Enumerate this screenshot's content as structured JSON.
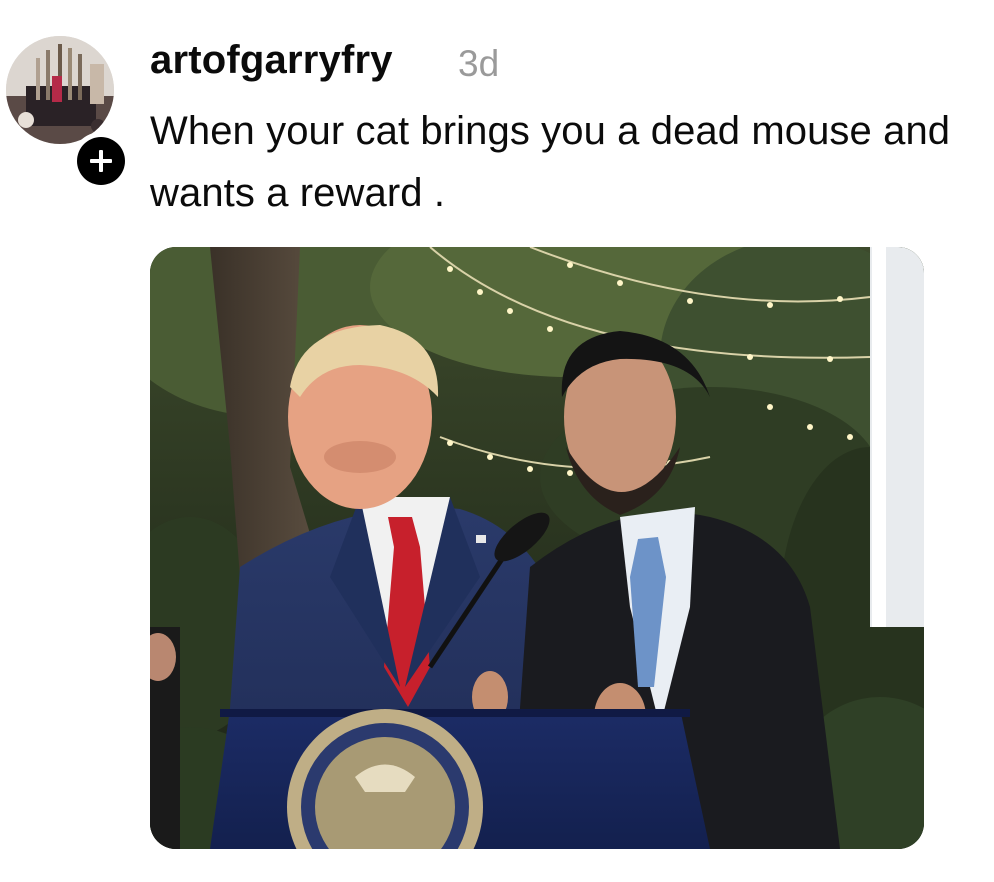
{
  "post": {
    "author": {
      "username": "artofgarryfry",
      "avatar_icon": "avatar-photo-brushes",
      "follow_icon": "plus-icon"
    },
    "timestamp": "3d",
    "caption": "When your cat brings you a dead mouse and wants a reward .",
    "media": {
      "type": "photo",
      "icon": "photo-media"
    }
  },
  "colors": {
    "text": "#0b0b0b",
    "muted": "#9a9a9a",
    "badge": "#000000",
    "background": "#ffffff"
  }
}
